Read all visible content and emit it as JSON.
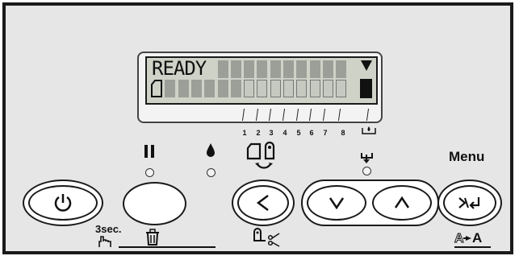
{
  "lcd": {
    "line1_text": "READY",
    "status_indicator": "down-triangle",
    "line2_icon": "paper-icon"
  },
  "tick_labels": [
    "1",
    "2",
    "3",
    "4",
    "5",
    "6",
    "7",
    "8"
  ],
  "labels": {
    "menu": "Menu",
    "three_sec": "3sec."
  },
  "icons": {
    "pause": "pause-icon",
    "ink": "ink-drop-icon",
    "paper_source": "paper-source-icon",
    "paper_feed": "paper-feed-icon",
    "hand": "hand-press-icon",
    "trash": "trash-icon",
    "cut": "paper-cut-icon",
    "font_change": "A-to-A-icon"
  },
  "buttons": {
    "power": "power-icon",
    "left": "<",
    "down": "v",
    "up": "^",
    "enter": "enter-icon"
  },
  "colors": {
    "panel_bg": "#e6e6e6",
    "lcd_bg": "#cfd2c7",
    "lcd_cell": "#9c9f98",
    "ink": "#1a1a1a"
  }
}
